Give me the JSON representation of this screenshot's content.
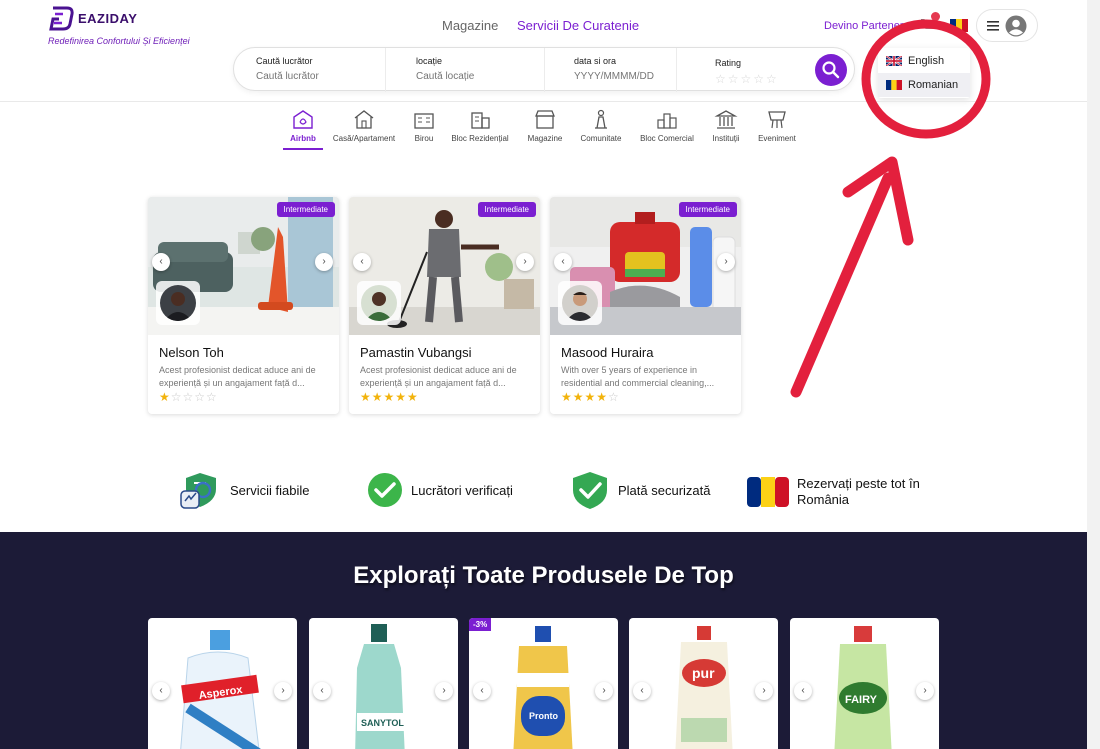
{
  "header": {
    "logo_text": "EAZIDAY",
    "tagline": "Redefinirea Confortului Și Eficienței",
    "nav": [
      {
        "label": "Magazine",
        "active": false
      },
      {
        "label": "Servicii De Curatenie",
        "active": true
      }
    ],
    "partner_link": "Devino Partener",
    "accent_color": "#7b1fd1"
  },
  "search": {
    "fields": [
      {
        "label": "Caută lucrător",
        "placeholder": "Caută lucrător"
      },
      {
        "label": "locație",
        "placeholder": "Caută locație"
      },
      {
        "label": "data si ora",
        "placeholder": "YYYY/MMMM/DD"
      },
      {
        "label": "Rating",
        "stars": "☆☆☆☆☆"
      }
    ]
  },
  "language_menu": {
    "items": [
      {
        "label": "English",
        "flag": "uk-flag-icon"
      },
      {
        "label": "Romanian",
        "flag": "romania-flag-icon"
      }
    ]
  },
  "categories": [
    {
      "label": "Airbnb",
      "icon": "airbnb-icon",
      "active": true
    },
    {
      "label": "Casă/Apartament",
      "icon": "house-icon"
    },
    {
      "label": "Birou",
      "icon": "office-icon"
    },
    {
      "label": "Bloc Rezidențial",
      "icon": "residential-block-icon"
    },
    {
      "label": "Magazine",
      "icon": "store-icon"
    },
    {
      "label": "Comunitate",
      "icon": "community-icon"
    },
    {
      "label": "Bloc Comercial",
      "icon": "commercial-block-icon"
    },
    {
      "label": "Instituții",
      "icon": "institution-icon"
    },
    {
      "label": "Eveniment",
      "icon": "event-icon"
    }
  ],
  "workers": [
    {
      "name": "Nelson Toh",
      "badge": "Intermediate",
      "description": "Acest profesionist dedicat aduce ani de experiență și un angajament față d...",
      "rating": 1
    },
    {
      "name": "Pamastin Vubangsi",
      "badge": "Intermediate",
      "description": "Acest profesionist dedicat aduce ani de experiență și un angajament față d...",
      "rating": 5
    },
    {
      "name": "Masood Huraira",
      "badge": "Intermediate",
      "description": "With over 5 years of experience in residential and commercial cleaning,...",
      "rating": 4
    }
  ],
  "features": [
    {
      "label": "Servicii fiabile",
      "icon": "shield-thumbs-up-icon"
    },
    {
      "label": "Lucrători verificați",
      "icon": "check-circle-icon"
    },
    {
      "label": "Plată securizată",
      "icon": "shield-check-icon"
    },
    {
      "label": "Rezervați peste tot în România",
      "icon": "romania-flag-icon"
    }
  ],
  "products": {
    "title": "Explorați Toate Produsele De Top",
    "items": [
      {
        "brand": "Asperox",
        "discount": ""
      },
      {
        "brand": "SANYTOL",
        "discount": ""
      },
      {
        "brand": "Pronto",
        "discount": "-3%"
      },
      {
        "brand": "pur",
        "discount": ""
      },
      {
        "brand": "FAIRY",
        "discount": ""
      }
    ]
  }
}
